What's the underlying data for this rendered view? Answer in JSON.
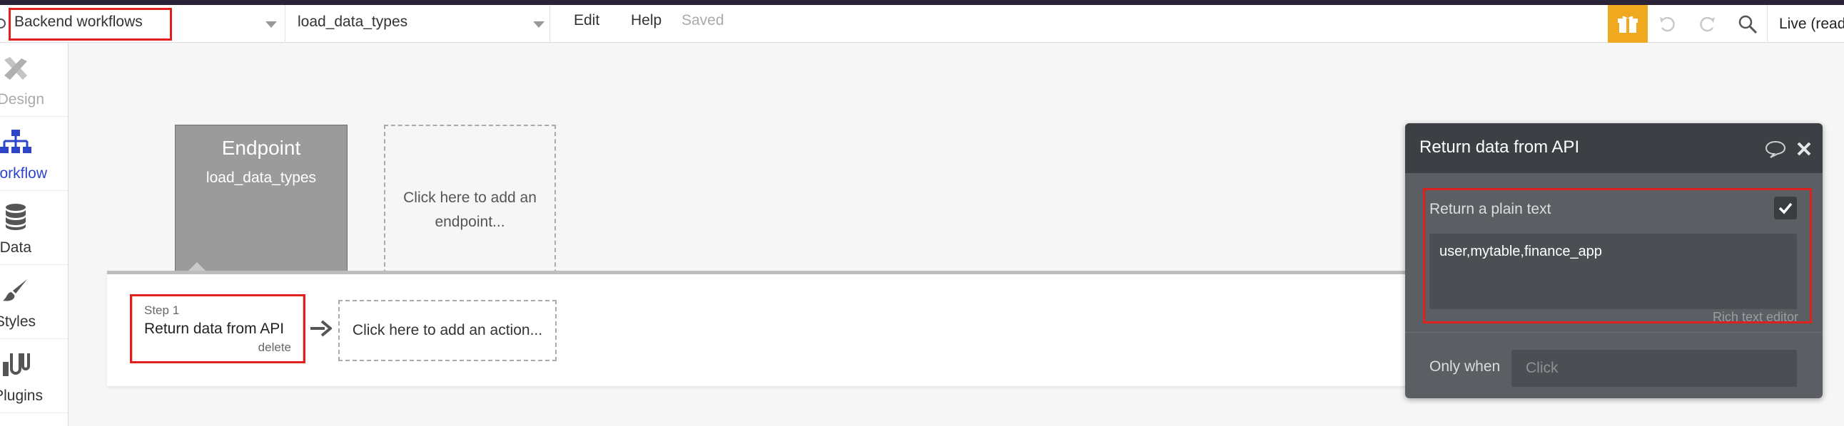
{
  "header": {
    "page_selector": "Backend workflows",
    "workflow_selector": "load_data_types",
    "menu_edit": "Edit",
    "menu_help": "Help",
    "save_status": "Saved",
    "live_label": "Live (read"
  },
  "sidebar": {
    "items": [
      {
        "label": "Design",
        "icon": "design-icon",
        "state": "disabled"
      },
      {
        "label": "Workflow",
        "icon": "workflow-icon",
        "state": "active"
      },
      {
        "label": "Data",
        "icon": "database-icon",
        "state": "normal"
      },
      {
        "label": "Styles",
        "icon": "brush-icon",
        "state": "normal"
      },
      {
        "label": "Plugins",
        "icon": "plug-icon",
        "state": "normal"
      }
    ]
  },
  "canvas": {
    "endpoint_title": "Endpoint",
    "endpoint_name": "load_data_types",
    "add_endpoint": "Click here to add an endpoint...",
    "step_number": "Step 1",
    "step_action": "Return data from API",
    "step_delete": "delete",
    "add_action": "Click here to add an action..."
  },
  "panel": {
    "title": "Return data from API",
    "plain_text_label": "Return a plain text",
    "plain_text_checked": true,
    "text_value": "user,mytable,finance_app",
    "rich_text_link": "Rich text editor",
    "only_when_label": "Only when",
    "only_when_placeholder": "Click"
  },
  "colors": {
    "highlight": "#e0201c",
    "accent_blue": "#2d45c6",
    "gift_orange": "#f0a81e",
    "panel_bg": "#5b5f63"
  }
}
